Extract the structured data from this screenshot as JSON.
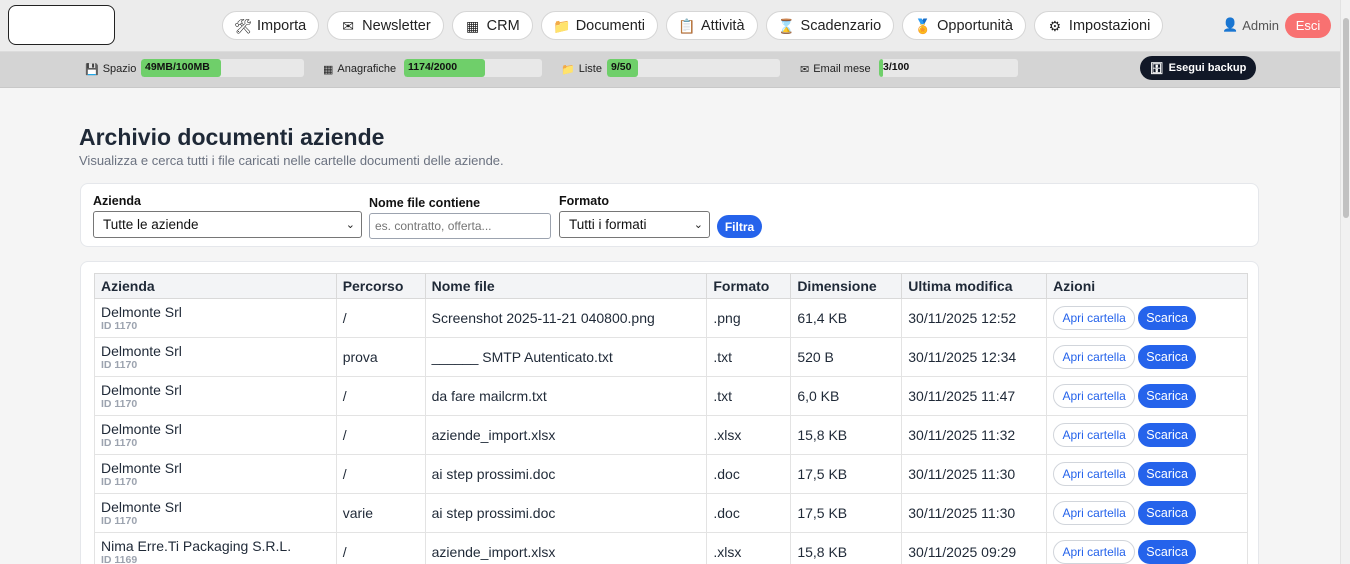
{
  "nav": {
    "items": [
      {
        "label": "Importa",
        "icon": "tools-icon",
        "glyph": "🛠"
      },
      {
        "label": "Newsletter",
        "icon": "envelope-icon",
        "glyph": "✉"
      },
      {
        "label": "CRM",
        "icon": "grid-icon",
        "glyph": "▦"
      },
      {
        "label": "Documenti",
        "icon": "folder-icon",
        "glyph": "📁"
      },
      {
        "label": "Attività",
        "icon": "clipboard-icon",
        "glyph": "📋"
      },
      {
        "label": "Scadenzario",
        "icon": "hourglass-icon",
        "glyph": "⌛"
      },
      {
        "label": "Opportunità",
        "icon": "medal-icon",
        "glyph": "🏅"
      },
      {
        "label": "Impostazioni",
        "icon": "gear-icon",
        "glyph": "⚙"
      }
    ],
    "user": "Admin",
    "logout": "Esci"
  },
  "quota": {
    "items": [
      {
        "label": "Spazio",
        "value": "49MB/100MB",
        "fraction": 0.49,
        "icon": "disk-icon",
        "glyph": "💾"
      },
      {
        "label": "Anagrafiche",
        "value": "1174/2000",
        "fraction": 0.587,
        "icon": "grid-icon",
        "glyph": "▦"
      },
      {
        "label": "Liste",
        "value": "9/50",
        "fraction": 0.18,
        "icon": "folder-icon",
        "glyph": "📁"
      },
      {
        "label": "Email mese",
        "value": "3/100",
        "fraction": 0.03,
        "icon": "envelope-icon",
        "glyph": "✉"
      }
    ],
    "backup": "Esegui backup"
  },
  "page": {
    "title": "Archivio documenti aziende",
    "subtitle": "Visualizza e cerca tutti i file caricati nelle cartelle documenti delle aziende."
  },
  "filters": {
    "azienda_label": "Azienda",
    "azienda_value": "Tutte le aziende",
    "nome_label": "Nome file contiene",
    "nome_placeholder": "es. contratto, offerta...",
    "formato_label": "Formato",
    "formato_value": "Tutti i formati",
    "submit": "Filtra"
  },
  "table": {
    "columns": [
      "Azienda",
      "Percorso",
      "Nome file",
      "Formato",
      "Dimensione",
      "Ultima modifica",
      "Azioni"
    ],
    "actions": {
      "open": "Apri cartella",
      "download": "Scarica"
    },
    "rows": [
      {
        "azienda": "Delmonte Srl",
        "id": "ID 1170",
        "percorso": "/",
        "file": "Screenshot 2025-11-21 040800.png",
        "formato": ".png",
        "dimensione": "61,4 KB",
        "modifica": "30/11/2025 12:52"
      },
      {
        "azienda": "Delmonte Srl",
        "id": "ID 1170",
        "percorso": "prova",
        "file": "______ SMTP Autenticato.txt",
        "formato": ".txt",
        "dimensione": "520 B",
        "modifica": "30/11/2025 12:34"
      },
      {
        "azienda": "Delmonte Srl",
        "id": "ID 1170",
        "percorso": "/",
        "file": "da fare mailcrm.txt",
        "formato": ".txt",
        "dimensione": "6,0 KB",
        "modifica": "30/11/2025 11:47"
      },
      {
        "azienda": "Delmonte Srl",
        "id": "ID 1170",
        "percorso": "/",
        "file": "aziende_import.xlsx",
        "formato": ".xlsx",
        "dimensione": "15,8 KB",
        "modifica": "30/11/2025 11:32"
      },
      {
        "azienda": "Delmonte Srl",
        "id": "ID 1170",
        "percorso": "/",
        "file": "ai step prossimi.doc",
        "formato": ".doc",
        "dimensione": "17,5 KB",
        "modifica": "30/11/2025 11:30"
      },
      {
        "azienda": "Delmonte Srl",
        "id": "ID 1170",
        "percorso": "varie",
        "file": "ai step prossimi.doc",
        "formato": ".doc",
        "dimensione": "17,5 KB",
        "modifica": "30/11/2025 11:30"
      },
      {
        "azienda": "Nima Erre.Ti Packaging S.R.L.",
        "id": "ID 1169",
        "percorso": "/",
        "file": "aziende_import.xlsx",
        "formato": ".xlsx",
        "dimensione": "15,8 KB",
        "modifica": "30/11/2025 09:29"
      }
    ]
  }
}
